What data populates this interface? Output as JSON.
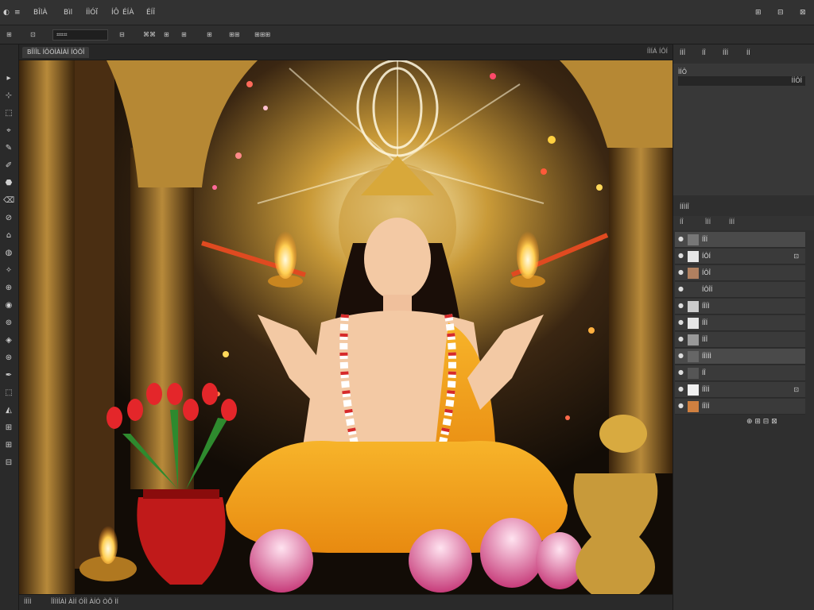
{
  "menubar": {
    "items": [
      "◐",
      "≡",
      "BÎlÀ",
      "Bìl",
      "ÍÌÓÏ",
      "ÍÔ",
      "ÉÍÀ",
      "ÉÍÎ"
    ],
    "right_icons": [
      "⊞",
      "⊟",
      "⊠"
    ]
  },
  "options_bar": {
    "items": [
      "⊞",
      "⊡",
      "⌗⌗⌗",
      "⊟",
      "⌘⌘",
      "⊞",
      "⊞",
      "⊞",
      "⊞⊞",
      "⊞⊞⊞"
    ],
    "field_placeholder": ""
  },
  "toolbar": {
    "tools": [
      "▸",
      "⊹",
      "⬚",
      "⌖",
      "✎",
      "✐",
      "⬣",
      "⌫",
      "⊘",
      "⌂",
      "◍",
      "✧",
      "⊕",
      "◉",
      "⊚",
      "◈",
      "⊛",
      "✒",
      "⬚",
      "◭",
      "⊞",
      "⊞",
      "⊟"
    ]
  },
  "document": {
    "tab_label": "BÎÌÎL ÍÔÒÌÀÌÀÍ ÍÒÔÎ",
    "tab_right": "ÍÌÍÁ ÍÔÍ",
    "status_left": "ÍÍÌÌ",
    "status_mid": "ÎÎÍÌÎÀÌ ÀÌÍ ÓÎÌ ÀÍÓ ÒÕ ÌÍ"
  },
  "panels": {
    "tabs": [
      "ÍÌÎ",
      "ÍÎ",
      "ÍÎÍ",
      "ÍÍ"
    ],
    "top_field_label": "ÌÍÔ",
    "top_field_value": "ÍÍÔÍ",
    "layers_header": "ÍÍÌÍÎ",
    "layers_tabs": [
      "ÍÎ",
      "ÎÍÍ",
      "ÍÍÍ"
    ],
    "layers": [
      {
        "name": "ÍÎÍ",
        "selected": true,
        "thumb": "#777"
      },
      {
        "name": "ÍÔÍ",
        "selected": false,
        "thumb": "#e6e6e6"
      },
      {
        "name": "ÍÔÎ",
        "selected": false,
        "thumb": "#b08060"
      },
      {
        "name": "ÍÔÎÍ",
        "selected": false,
        "thumb": "#3a3a3a"
      },
      {
        "name": "ÍÎÍÌ",
        "selected": false,
        "thumb": "#cccccc"
      },
      {
        "name": "ÍÎÍ",
        "selected": false,
        "thumb": "#e5e5e5"
      },
      {
        "name": "ÍÍÎ",
        "selected": false,
        "thumb": "#999999"
      },
      {
        "name": "ÍÎÍÍÌ",
        "selected": true,
        "thumb": "#666"
      },
      {
        "name": "ÍÎ",
        "selected": false,
        "thumb": "#555"
      },
      {
        "name": "ÍÎÍÍ",
        "selected": false,
        "thumb": "#f0f0f0"
      },
      {
        "name": "ÍÎÍÍ",
        "selected": false,
        "thumb": "#d08040"
      }
    ],
    "layers_footer": "⊕ ⊞ ⊟ ⊠"
  },
  "colors": {
    "background": "#2b2b2b",
    "accent_gold": "#d8a83a",
    "saffron": "#f2a21a"
  }
}
